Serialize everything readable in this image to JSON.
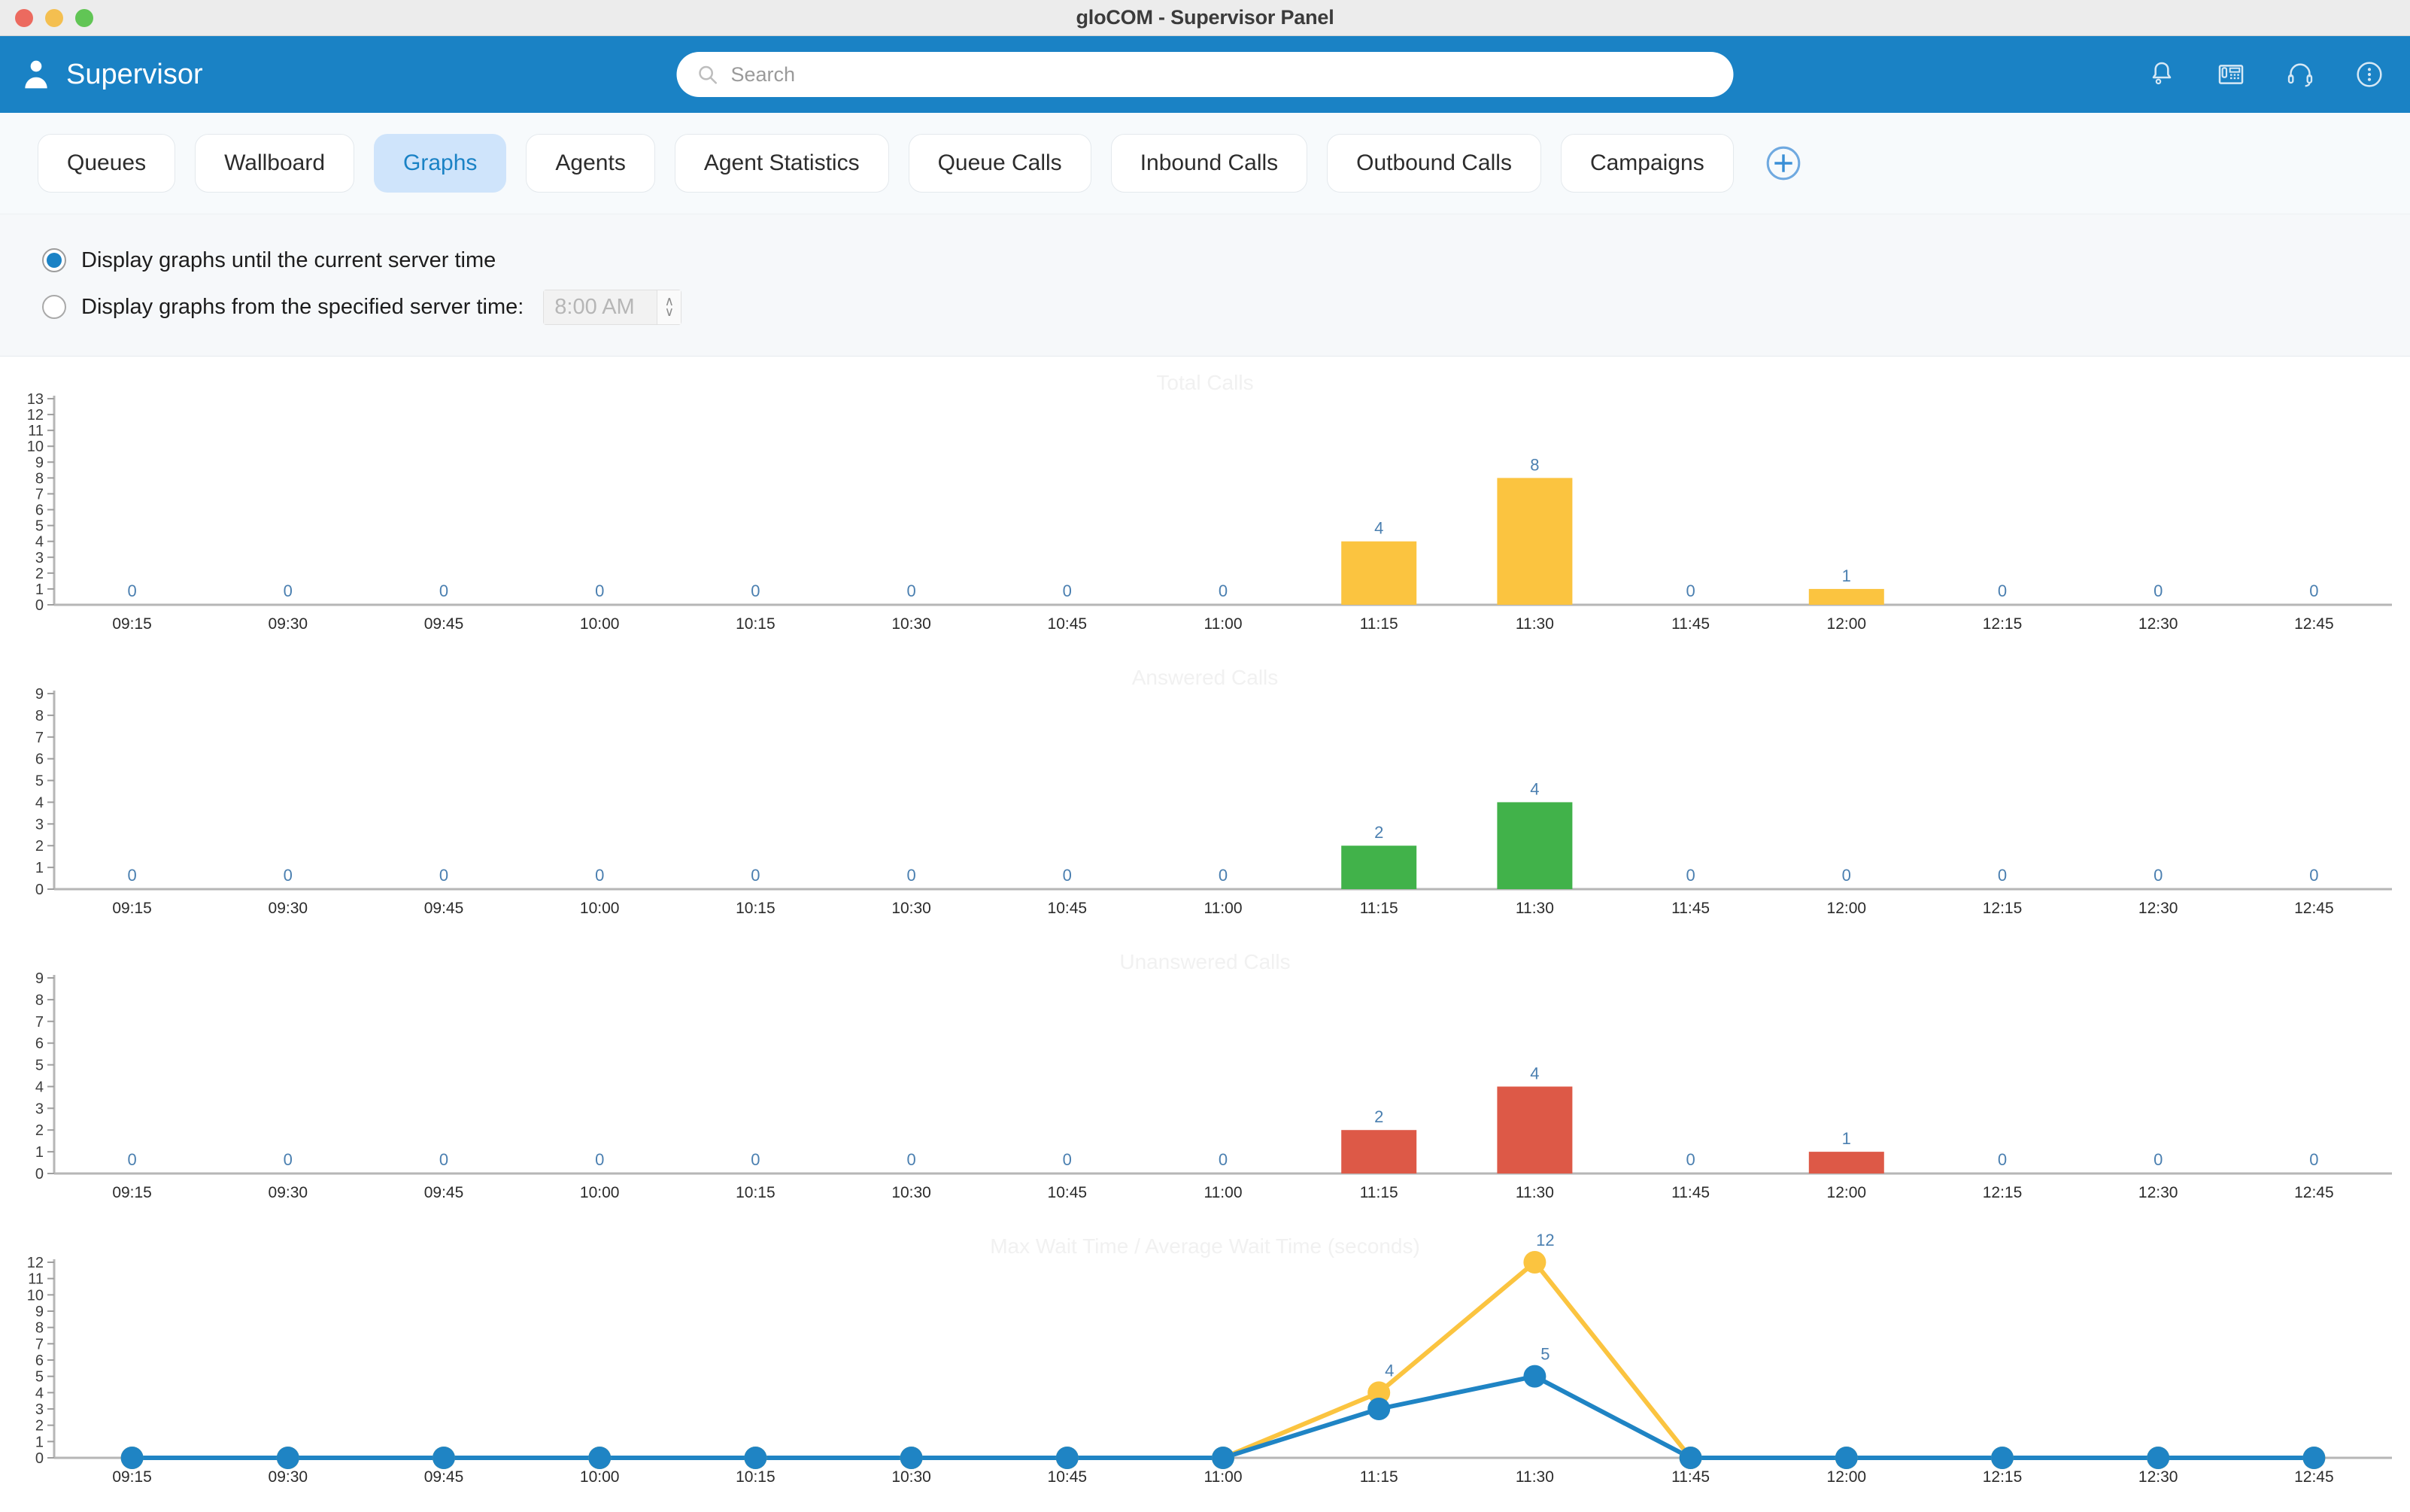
{
  "window": {
    "title": "gloCOM - Supervisor Panel",
    "traffic_lights": [
      "close",
      "minimize",
      "zoom"
    ]
  },
  "header": {
    "brand_label": "Supervisor",
    "brand_icon": "user-icon",
    "search": {
      "placeholder": "Search",
      "value": "",
      "icon": "search-icon"
    },
    "icons": [
      {
        "name": "bell-icon",
        "label": "Notifications"
      },
      {
        "name": "desk-phone-icon",
        "label": "Phone"
      },
      {
        "name": "headset-icon",
        "label": "Headset"
      },
      {
        "name": "more-vertical-icon",
        "label": "More options"
      }
    ]
  },
  "tabs": {
    "items": [
      {
        "label": "Queues",
        "active": false
      },
      {
        "label": "Wallboard",
        "active": false
      },
      {
        "label": "Graphs",
        "active": true
      },
      {
        "label": "Agents",
        "active": false
      },
      {
        "label": "Agent Statistics",
        "active": false
      },
      {
        "label": "Queue Calls",
        "active": false
      },
      {
        "label": "Inbound Calls",
        "active": false
      },
      {
        "label": "Outbound Calls",
        "active": false
      },
      {
        "label": "Campaigns",
        "active": false
      }
    ],
    "add_icon": "plus-circle-icon"
  },
  "options": {
    "radio_current": {
      "label": "Display graphs until the current server time",
      "selected": true
    },
    "radio_specified": {
      "label": "Display graphs from the specified server time:",
      "selected": false
    },
    "time_value": "8:00 AM",
    "spinner_up": "∧",
    "spinner_down": "∨"
  },
  "accent_colors": {
    "brand_blue": "#1a82c5",
    "tab_active_bg": "#cfe4fb",
    "bar_yellow": "#fbc440",
    "bar_green": "#41b24a",
    "bar_red": "#dd5947",
    "line_blue": "#1f84c4",
    "label_blue": "#4a7fb0",
    "chart_title_gray": "#f1f1f1"
  },
  "chart_data": [
    {
      "type": "bar",
      "title": "Total Calls",
      "xlabel": "",
      "ylabel": "",
      "ylim": [
        0,
        13
      ],
      "yticks": [
        0,
        1,
        2,
        3,
        4,
        5,
        6,
        7,
        8,
        9,
        10,
        11,
        12,
        13
      ],
      "grid": false,
      "color": "#fbc440",
      "categories": [
        "09:15",
        "09:30",
        "09:45",
        "10:00",
        "10:15",
        "10:30",
        "10:45",
        "11:00",
        "11:15",
        "11:30",
        "11:45",
        "12:00",
        "12:15",
        "12:30",
        "12:45"
      ],
      "values": [
        0,
        0,
        0,
        0,
        0,
        0,
        0,
        0,
        4,
        8,
        0,
        1,
        0,
        0,
        0
      ]
    },
    {
      "type": "bar",
      "title": "Answered Calls",
      "xlabel": "",
      "ylabel": "",
      "ylim": [
        0,
        9
      ],
      "yticks": [
        0,
        1,
        2,
        3,
        4,
        5,
        6,
        7,
        8,
        9
      ],
      "grid": false,
      "color": "#41b24a",
      "categories": [
        "09:15",
        "09:30",
        "09:45",
        "10:00",
        "10:15",
        "10:30",
        "10:45",
        "11:00",
        "11:15",
        "11:30",
        "11:45",
        "12:00",
        "12:15",
        "12:30",
        "12:45"
      ],
      "values": [
        0,
        0,
        0,
        0,
        0,
        0,
        0,
        0,
        2,
        4,
        0,
        0,
        0,
        0,
        0
      ]
    },
    {
      "type": "bar",
      "title": "Unanswered Calls",
      "xlabel": "",
      "ylabel": "",
      "ylim": [
        0,
        9
      ],
      "yticks": [
        0,
        1,
        2,
        3,
        4,
        5,
        6,
        7,
        8,
        9
      ],
      "grid": false,
      "color": "#dd5947",
      "categories": [
        "09:15",
        "09:30",
        "09:45",
        "10:00",
        "10:15",
        "10:30",
        "10:45",
        "11:00",
        "11:15",
        "11:30",
        "11:45",
        "12:00",
        "12:15",
        "12:30",
        "12:45"
      ],
      "values": [
        0,
        0,
        0,
        0,
        0,
        0,
        0,
        0,
        2,
        4,
        0,
        1,
        0,
        0,
        0
      ]
    },
    {
      "type": "line",
      "title": "Max Wait Time / Average Wait Time (seconds)",
      "xlabel": "",
      "ylabel": "",
      "ylim": [
        0,
        12
      ],
      "yticks": [
        0,
        1,
        2,
        3,
        4,
        5,
        6,
        7,
        8,
        9,
        10,
        11,
        12
      ],
      "grid": false,
      "legend": [
        "Max Wait Time",
        "Average Wait Time"
      ],
      "categories": [
        "09:15",
        "09:30",
        "09:45",
        "10:00",
        "10:15",
        "10:30",
        "10:45",
        "11:00",
        "11:15",
        "11:30",
        "11:45",
        "12:00",
        "12:15",
        "12:30",
        "12:45"
      ],
      "series": [
        {
          "name": "Max Wait Time",
          "color": "#fbc440",
          "values": [
            0,
            0,
            0,
            0,
            0,
            0,
            0,
            0,
            4,
            12,
            0,
            0,
            0,
            0,
            0
          ],
          "point_labels": [
            "",
            "",
            "",
            "",
            "",
            "",
            "",
            "",
            "4",
            "12",
            "",
            "",
            "",
            "",
            ""
          ]
        },
        {
          "name": "Average Wait Time",
          "color": "#1f84c4",
          "values": [
            0,
            0,
            0,
            0,
            0,
            0,
            0,
            0,
            3,
            5,
            0,
            0,
            0,
            0,
            0
          ],
          "point_labels": [
            "",
            "",
            "",
            "",
            "",
            "",
            "",
            "",
            "",
            "5",
            "",
            "",
            "",
            "",
            ""
          ]
        }
      ]
    }
  ]
}
